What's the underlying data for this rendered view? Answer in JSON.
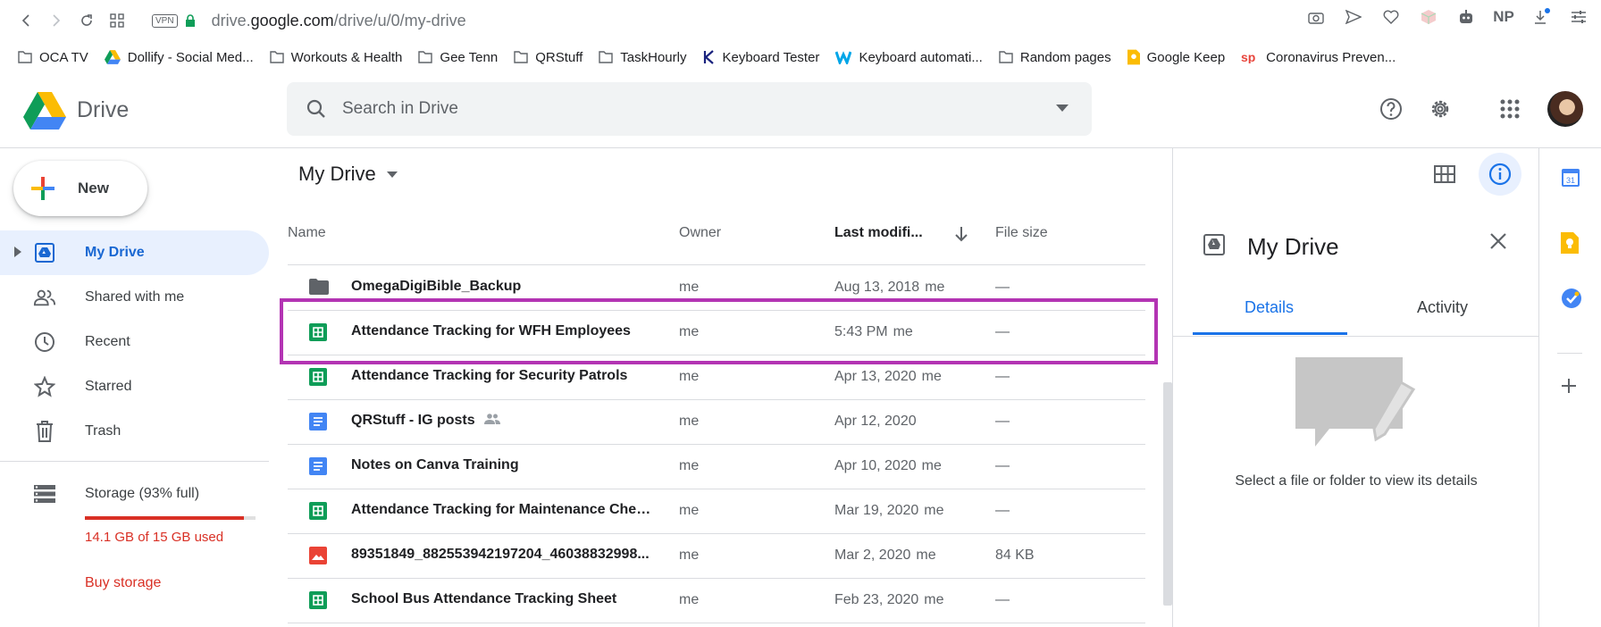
{
  "browser": {
    "vpn": "VPN",
    "url_prefix": "drive.",
    "url_domain": "google.com",
    "url_path": "/drive/u/0/my-drive",
    "extension_np": "NP"
  },
  "bookmarks": [
    {
      "label": "OCA TV",
      "icon": "folder-icon"
    },
    {
      "label": "Dollify - Social Med...",
      "icon": "drive-icon"
    },
    {
      "label": "Workouts & Health",
      "icon": "folder-icon"
    },
    {
      "label": "Gee Tenn",
      "icon": "folder-icon"
    },
    {
      "label": "QRStuff",
      "icon": "folder-icon"
    },
    {
      "label": "TaskHourly",
      "icon": "folder-icon"
    },
    {
      "label": "Keyboard Tester",
      "icon": "k-icon"
    },
    {
      "label": "Keyboard automati...",
      "icon": "w-icon"
    },
    {
      "label": "Random pages",
      "icon": "folder-icon"
    },
    {
      "label": "Google Keep",
      "icon": "keep-icon"
    },
    {
      "label": "Coronavirus Preven...",
      "icon": "sp-icon"
    }
  ],
  "header": {
    "app_name": "Drive",
    "search_placeholder": "Search in Drive"
  },
  "sidebar": {
    "new_label": "New",
    "items": [
      {
        "label": "My Drive",
        "icon": "my-drive-icon",
        "active": true
      },
      {
        "label": "Shared with me",
        "icon": "shared-icon"
      },
      {
        "label": "Recent",
        "icon": "clock-icon"
      },
      {
        "label": "Starred",
        "icon": "star-icon"
      },
      {
        "label": "Trash",
        "icon": "trash-icon"
      }
    ],
    "storage_label": "Storage (93% full)",
    "storage_fraction": 0.93,
    "storage_used": "14.1 GB of 15 GB used",
    "buy_storage": "Buy storage"
  },
  "main": {
    "breadcrumb": "My Drive",
    "columns": {
      "name": "Name",
      "owner": "Owner",
      "modified": "Last modifi...",
      "size": "File size"
    },
    "files": [
      {
        "name": "OmegaDigiBible_Backup",
        "type": "folder",
        "owner": "me",
        "modified": "Aug 13, 2018",
        "modified_by": "me",
        "size": "—"
      },
      {
        "name": "Attendance Tracking for WFH Employees",
        "type": "sheet",
        "owner": "me",
        "modified": "5:43 PM",
        "modified_by": "me",
        "size": "—"
      },
      {
        "name": "Attendance Tracking for Security Patrols",
        "type": "sheet",
        "owner": "me",
        "modified": "Apr 13, 2020",
        "modified_by": "me",
        "size": "—"
      },
      {
        "name": "QRStuff - IG posts",
        "type": "doc",
        "shared": true,
        "owner": "me",
        "modified": "Apr 12, 2020",
        "modified_by": "",
        "size": "—"
      },
      {
        "name": "Notes on Canva Training",
        "type": "doc",
        "owner": "me",
        "modified": "Apr 10, 2020",
        "modified_by": "me",
        "size": "—"
      },
      {
        "name": "Attendance Tracking for Maintenance Checks",
        "type": "sheet",
        "owner": "me",
        "modified": "Mar 19, 2020",
        "modified_by": "me",
        "size": "—"
      },
      {
        "name": "89351849_882553942197204_46038832998...",
        "type": "image",
        "owner": "me",
        "modified": "Mar 2, 2020",
        "modified_by": "me",
        "size": "84 KB"
      },
      {
        "name": "School Bus Attendance Tracking Sheet",
        "type": "sheet",
        "owner": "me",
        "modified": "Feb 23, 2020",
        "modified_by": "me",
        "size": "—"
      }
    ]
  },
  "details": {
    "title": "My Drive",
    "tab_details": "Details",
    "tab_activity": "Activity",
    "message": "Select a file or folder to view its details"
  },
  "side_panel": {
    "calendar_day": "31"
  },
  "colors": {
    "accent_blue": "#1a73e8",
    "highlight_purple": "#b334b3",
    "storage_red": "#d93025",
    "sheets_green": "#0f9d58",
    "docs_blue": "#4285f4",
    "image_red": "#ea4335"
  }
}
